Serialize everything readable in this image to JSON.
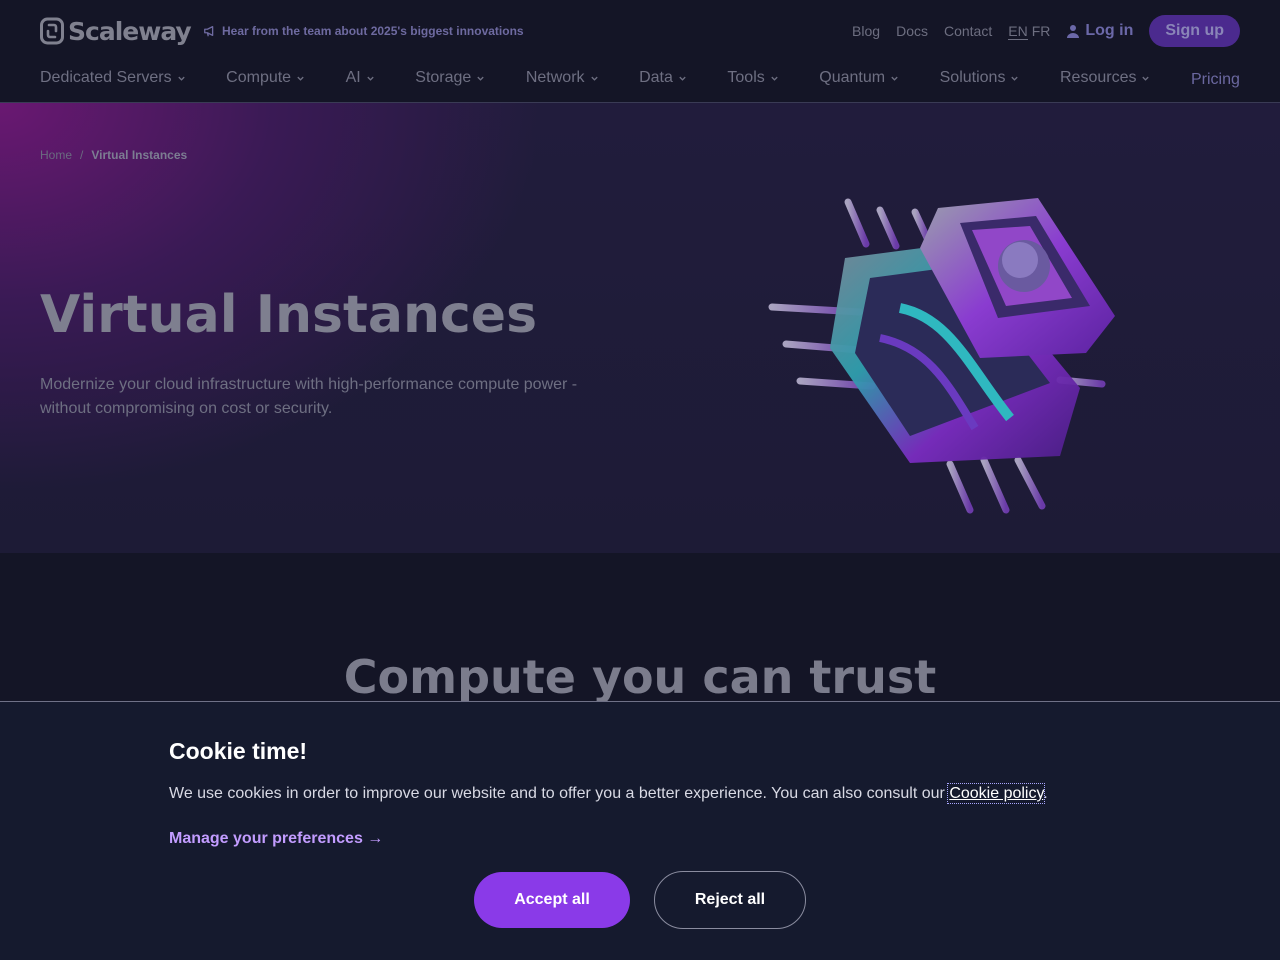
{
  "header": {
    "logo_text": "Scaleway",
    "announcement": "Hear from the team about 2025's biggest innovations",
    "top_links": [
      "Blog",
      "Docs",
      "Contact"
    ],
    "lang_active": "EN",
    "lang_other": "FR",
    "login_label": "Log in",
    "signup_label": "Sign up",
    "nav": [
      "Dedicated Servers",
      "Compute",
      "AI",
      "Storage",
      "Network",
      "Data",
      "Tools",
      "Quantum",
      "Solutions",
      "Resources"
    ],
    "pricing_label": "Pricing"
  },
  "hero": {
    "breadcrumb_home": "Home",
    "breadcrumb_separator": "/",
    "breadcrumb_current": "Virtual Instances",
    "title": "Virtual Instances",
    "subtitle": "Modernize your cloud infrastructure with high-performance compute power - without compromising on cost or security."
  },
  "section": {
    "title": "Compute you can trust"
  },
  "cookie": {
    "title": "Cookie time!",
    "text_before": "We use cookies in order to improve our website and to offer you a better experience. You can also consult our ",
    "policy_link": "Cookie policy",
    "text_after": ".",
    "manage_label": "Manage your preferences →",
    "accept_label": "Accept all",
    "reject_label": "Reject all"
  },
  "colors": {
    "background": "#141526",
    "accent": "#8a3ae8",
    "link": "#c29cff"
  }
}
